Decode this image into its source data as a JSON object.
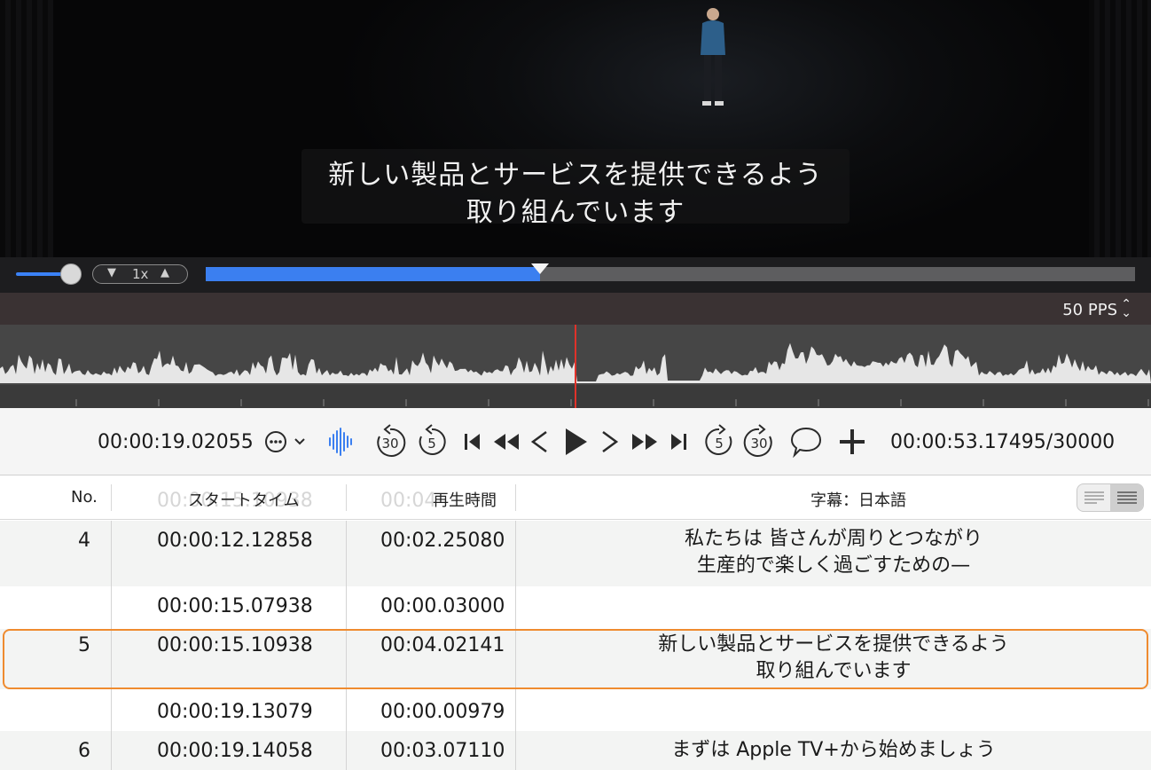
{
  "video": {
    "subtitle_line1": "新しい製品とサービスを提供できるよう",
    "subtitle_line2": "取り組んでいます"
  },
  "playback": {
    "speed_label": "1x",
    "progress_fraction": 0.36,
    "volume_fraction": 0.8
  },
  "waveform": {
    "pps_label": "50 PPS",
    "playhead_fraction": 0.5
  },
  "toolbar": {
    "current_time": "00:00:19.02055",
    "total_time": "00:00:53.17495/30000",
    "icons": [
      "more-options-icon",
      "waveform-icon",
      "skip-back-30-icon",
      "skip-back-5-icon",
      "go-to-start-icon",
      "rewind-icon",
      "previous-frame-icon",
      "play-icon",
      "next-frame-icon",
      "fast-forward-icon",
      "go-to-end-icon",
      "skip-forward-5-icon",
      "skip-forward-30-icon",
      "speech-bubble-icon",
      "add-icon"
    ]
  },
  "table": {
    "headers": {
      "no": "No.",
      "start": "スタートタイム",
      "duration": "再生時間",
      "subtitle": "字幕：日本語"
    },
    "rows": [
      {
        "no": "4",
        "start": "00:00:12.12858",
        "duration": "00:02.25080",
        "line1": "私たちは 皆さんが周りとつながり",
        "line2": "生産的で楽しく過ごすための—"
      },
      {
        "no": "",
        "start": "00:00:15.07938",
        "duration": "00:00.03000",
        "line1": "",
        "line2": ""
      },
      {
        "no": "5",
        "start": "00:00:15.10938",
        "duration": "00:04.02141",
        "line1": "新しい製品とサービスを提供できるよう",
        "line2": "取り組んでいます"
      },
      {
        "no": "",
        "start": "00:00:19.13079",
        "duration": "00:00.00979",
        "line1": "",
        "line2": ""
      },
      {
        "no": "6",
        "start": "00:00:19.14058",
        "duration": "00:03.07110",
        "line1": "まずは Apple TV+から始めましょう",
        "line2": ""
      }
    ]
  },
  "colors": {
    "accent_blue": "#3b7ff0",
    "selection_orange": "#ef8b2f",
    "playhead_red": "#e0322a"
  }
}
